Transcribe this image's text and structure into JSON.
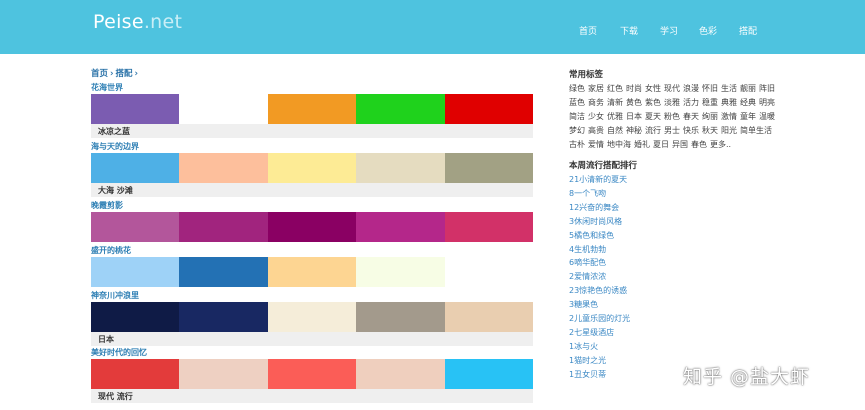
{
  "header": {
    "logo_main": "Peise",
    "logo_domain": ".net",
    "nav": [
      "首页",
      "下载",
      "学习",
      "色彩",
      "搭配"
    ]
  },
  "breadcrumb": {
    "home": "首页",
    "current": "搭配",
    "sep": "›"
  },
  "palettes": [
    {
      "title": "花海世界",
      "tags": "冰凉之蓝",
      "colors": [
        "#7b5cb1",
        "#ffffff",
        "#f29a23",
        "#1fd21c",
        "#e00000"
      ]
    },
    {
      "title": "海与天的边界",
      "tags": "大海 沙滩",
      "colors": [
        "#4eb0e6",
        "#fdbf9c",
        "#fdeb95",
        "#e5dcc0",
        "#a2a184"
      ]
    },
    {
      "title": "晚霞剪影",
      "tags": "",
      "colors": [
        "#b3569b",
        "#a1247e",
        "#8a0063",
        "#b4278a",
        "#d23168"
      ]
    },
    {
      "title": "盛开的桃花",
      "tags": "",
      "colors": [
        "#9ed2f7",
        "#2371b4",
        "#fdd592",
        "#f7fde5",
        "#ffffff"
      ]
    },
    {
      "title": "神奈川冲浪里",
      "tags": "日本",
      "colors": [
        "#0f1b46",
        "#182862",
        "#f5edd9",
        "#a39a8c",
        "#e9ceb0"
      ]
    },
    {
      "title": "美好时代的回忆",
      "tags": "现代 流行",
      "colors": [
        "#e33b3b",
        "#eed0c2",
        "#fb5d57",
        "#efcfbe",
        "#28c2f5"
      ]
    }
  ],
  "sidebar": {
    "tags_heading": "常用标签",
    "tags": [
      "绿色",
      "家居",
      "红色",
      "时尚",
      "女性",
      "现代",
      "浪漫",
      "怀旧",
      "生活",
      "靓丽",
      "阵旧",
      "蓝色",
      "商务",
      "清新",
      "黄色",
      "紫色",
      "淡雅",
      "活力",
      "稳重",
      "典雅",
      "经典",
      "明亮",
      "简洁",
      "少女",
      "优雅",
      "日本",
      "夏天",
      "粉色",
      "春天",
      "绚丽",
      "激情",
      "童年",
      "温暖",
      "梦幻",
      "高贵",
      "自然",
      "神秘",
      "流行",
      "男士",
      "快乐",
      "秋天",
      "阳光",
      "简单生活",
      "古朴",
      "爱情",
      "地中海",
      "婚礼",
      "夏日",
      "异国",
      "春色",
      "更多.."
    ],
    "ranking_heading": "本周流行搭配排行",
    "ranking": [
      "21小清新的夏天",
      "8一个飞吻",
      "12兴奋的舞会",
      "3休闲时尚风格",
      "5橘色和绿色",
      "4生机勃勃",
      "6嘀华配色",
      "2爱情浓浓",
      "23惊艳色的诱惑",
      "3糖果色",
      "2儿童乐园的灯光",
      "2七星级酒店",
      "1冰与火",
      "1猫时之光",
      "1丑女贝蒂"
    ]
  },
  "watermark": "知乎 @盐大虾"
}
